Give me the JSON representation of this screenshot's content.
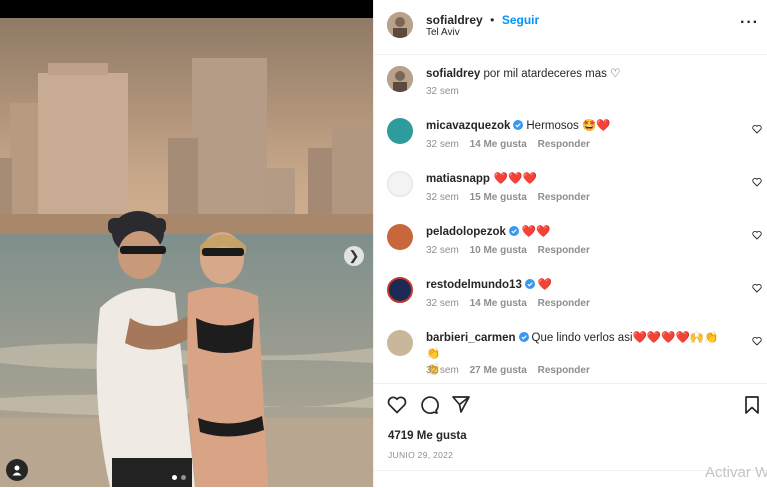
{
  "post": {
    "username": "sofialdrey",
    "follow_label": "Seguir",
    "location": "Tel Aviv",
    "caption_text": "por mil atardeceres mas ♡",
    "caption_time": "32 sem"
  },
  "comments": [
    {
      "user": "micavazquezok",
      "verified": true,
      "text": "Hermosos 🤩❤️",
      "time": "32 sem",
      "likes": "14 Me gusta",
      "reply": "Responder",
      "avatar_color": "#2e9c9a"
    },
    {
      "user": "matiasnapp",
      "verified": false,
      "text": "❤️❤️❤️",
      "time": "32 sem",
      "likes": "15 Me gusta",
      "reply": "Responder",
      "avatar_color": "#f3f3f3"
    },
    {
      "user": "peladolopezok",
      "verified": true,
      "text": "❤️❤️",
      "time": "32 sem",
      "likes": "10 Me gusta",
      "reply": "Responder",
      "avatar_color": "#c8663c"
    },
    {
      "user": "restodelmundo13",
      "verified": true,
      "text": "❤️",
      "time": "32 sem",
      "likes": "14 Me gusta",
      "reply": "Responder",
      "avatar_color": "#1c2a55"
    },
    {
      "user": "barbieri_carmen",
      "verified": true,
      "text": "Que lindo verlos asi❤️❤️❤️❤️🙌👏👏",
      "text2": "👏",
      "time": "32 sem",
      "likes": "27 Me gusta",
      "reply": "Responder",
      "avatar_color": "#c9b79a"
    }
  ],
  "footer": {
    "likes_count": "4719 Me gusta",
    "date": "JUNIO 29, 2022"
  },
  "watermark": "Activar W",
  "icons": [
    "more-icon",
    "heart-icon",
    "comment-icon",
    "share-icon",
    "bookmark-icon",
    "chevron-right-icon",
    "user-tag-icon",
    "verified-icon"
  ],
  "colors": {
    "accent": "#0095f6",
    "text": "#262626",
    "muted": "#8e8e8e",
    "verified": "#3897f0"
  }
}
